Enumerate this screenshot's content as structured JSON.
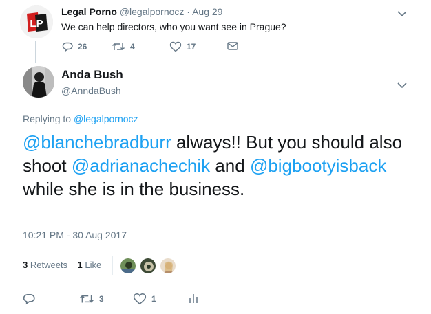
{
  "parent": {
    "name": "Legal Porno",
    "handle": "@legalpornocz",
    "dot": "·",
    "date": "Aug 29",
    "text": "We can help directors, who you want see in Prague?",
    "replies": "26",
    "retweets": "4",
    "likes": "17",
    "avatar_logo_text": "LP"
  },
  "tweet": {
    "name": "Anda Bush",
    "handle": "@AnndaBush",
    "replying_label": "Replying to",
    "replying_to": "@legalpornocz",
    "text_parts": {
      "m1": "@blanchebradburr",
      "t1": " always!! But you should also shoot ",
      "m2": "@adrianachechik",
      "t2": " and ",
      "m3": "@bigbootyisback",
      "t3": " while she is in the business."
    },
    "timestamp": "10:21 PM - 30 Aug 2017",
    "retweet_count": "3",
    "retweet_label": "Retweets",
    "like_count": "1",
    "like_label": "Like",
    "reply_action_count": "",
    "retweet_action_count": "3",
    "like_action_count": "1"
  },
  "colors": {
    "link": "#1da1f2",
    "secondary_text": "#657786",
    "primary_text": "#14171a",
    "divider": "#e6ecf0"
  }
}
